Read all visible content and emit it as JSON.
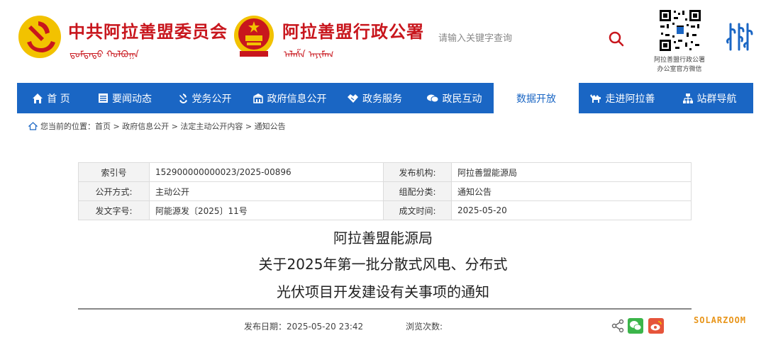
{
  "header": {
    "party_title": "中共阿拉善盟委员会",
    "party_mongol": "ᠳ᠋ᠤᠮᠳᠠᠳᠤ ᠬᠣᠯᠪᠤᠭᠠ",
    "gov_title": "阿拉善盟行政公署",
    "gov_mongol": "ᠠᠯᠠᠱᠠ ᠠᠶᠢᠮᠠᠭ",
    "search_placeholder": "请输入关键字查询",
    "qr_caption_line1": "阿拉善盟行政公署",
    "qr_caption_line2": "办公室官方微信"
  },
  "nav": [
    {
      "label": "首 页",
      "icon": "home-icon"
    },
    {
      "label": "要闻动态",
      "icon": "news-icon"
    },
    {
      "label": "党务公开",
      "icon": "party-icon"
    },
    {
      "label": "政府信息公开",
      "icon": "building-icon"
    },
    {
      "label": "政务服务",
      "icon": "handshake-icon"
    },
    {
      "label": "政民互动",
      "icon": "chat-icon"
    },
    {
      "label": "数据开放",
      "icon": ""
    },
    {
      "label": "走进阿拉善",
      "icon": "camel-icon"
    },
    {
      "label": "站群导航",
      "icon": "sitemap-icon"
    }
  ],
  "breadcrumb": {
    "prefix": "您当前的位置：",
    "path": "首页 > 政府信息公开 > 法定主动公开内容 > 通知公告"
  },
  "info": {
    "rows": [
      {
        "l1": "索引号",
        "v1": "152900000000023/2025-00896",
        "l2": "发布机构:",
        "v2": "阿拉善盟能源局"
      },
      {
        "l1": "公开方式:",
        "v1": "主动公开",
        "l2": "组配分类:",
        "v2": "通知公告"
      },
      {
        "l1": "发文字号:",
        "v1": "阿能源发〔2025〕11号",
        "l2": "成文时间:",
        "v2": "2025-05-20"
      }
    ]
  },
  "title": {
    "line1": "阿拉善盟能源局",
    "line2": "关于2025年第一批分散式风电、分布式",
    "line3": "光伏项目开发建设有关事项的通知"
  },
  "meta": {
    "publish_label": "发布日期：",
    "publish_value": "2025-05-20 23:42",
    "views_label": "浏览次数:"
  },
  "watermark": "SOLARZOOM",
  "colors": {
    "brand_red": "#c8161d",
    "nav_blue": "#1a66c4",
    "wechat_green": "#3bb54a",
    "weibo_red": "#e6543a"
  }
}
